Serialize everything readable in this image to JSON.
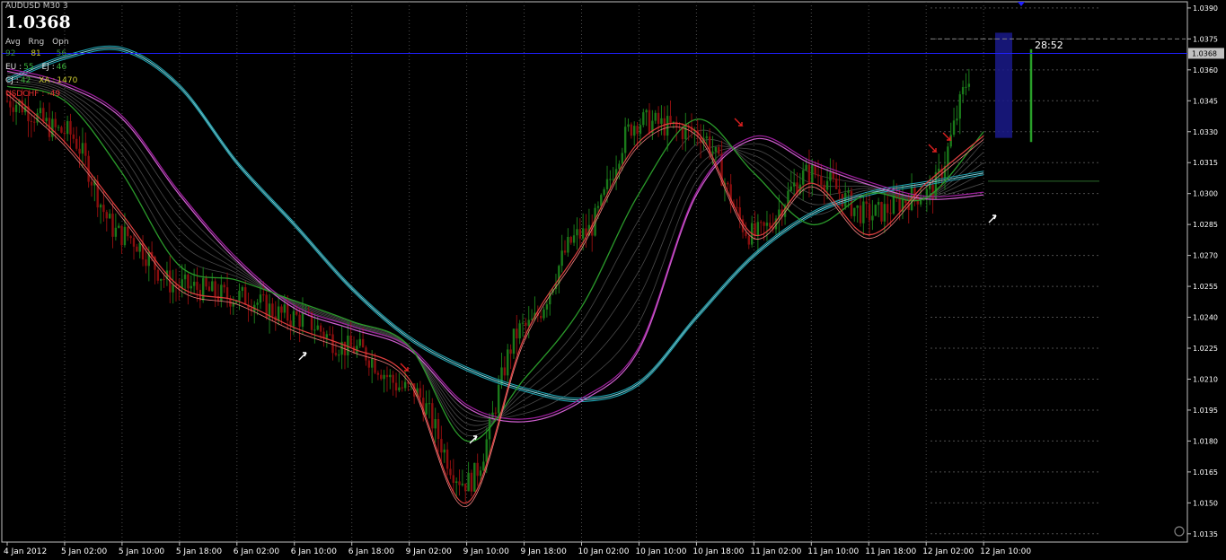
{
  "window": {
    "title": "AUDUSD M30 3"
  },
  "info_panel": {
    "price": "1.0368",
    "col_labels": [
      "Avg",
      "Rng",
      "Opn"
    ],
    "col_values": [
      "92",
      "81",
      "56"
    ],
    "pairs_row1": [
      {
        "label": "EU :",
        "value": "55"
      },
      {
        "label": "EJ :",
        "value": "46"
      }
    ],
    "pairs_row2": [
      {
        "label": "CJ :",
        "value": "42"
      },
      {
        "label": "XA :",
        "value": "1470"
      }
    ],
    "usdchf": {
      "label": "USDCHF :",
      "value": "-49"
    }
  },
  "countdown": "28:52",
  "colors": {
    "background": "#000000",
    "grid": "#4d4d4d",
    "axis": "#c0c0c0",
    "bid_line": "#2020ff",
    "bull": "#1a7a1a",
    "bear": "#8a0e0e",
    "teal": "#1fa7b6",
    "magenta": "#a020a0",
    "green_ma": "#2a9a2a",
    "red_ma": "#e04040"
  },
  "chart_data": {
    "type": "line",
    "symbol": "AUDUSD",
    "timeframe": "M30",
    "bid": 1.0368,
    "ylim": [
      1.0131,
      1.0393
    ],
    "yticks": [
      "1.0390",
      "1.0375",
      "1.0360",
      "1.0345",
      "1.0330",
      "1.0315",
      "1.0300",
      "1.0285",
      "1.0270",
      "1.0255",
      "1.0240",
      "1.0225",
      "1.0210",
      "1.0195",
      "1.0180",
      "1.0165",
      "1.0150",
      "1.0135"
    ],
    "xticks": [
      "4 Jan 2012",
      "5 Jan 02:00",
      "5 Jan 10:00",
      "5 Jan 18:00",
      "6 Jan 02:00",
      "6 Jan 10:00",
      "6 Jan 18:00",
      "9 Jan 02:00",
      "9 Jan 10:00",
      "9 Jan 18:00",
      "10 Jan 02:00",
      "10 Jan 10:00",
      "10 Jan 18:00",
      "11 Jan 02:00",
      "11 Jan 10:00",
      "11 Jan 18:00",
      "12 Jan 02:00",
      "12 Jan 10:00"
    ],
    "series": [
      {
        "role": "slow-teal",
        "x": [
          "4 Jan 2012",
          "5 Jan 02:00",
          "5 Jan 10:00",
          "5 Jan 18:00",
          "6 Jan 02:00",
          "6 Jan 10:00",
          "6 Jan 18:00",
          "9 Jan 02:00",
          "9 Jan 10:00",
          "9 Jan 18:00",
          "10 Jan 02:00",
          "10 Jan 10:00",
          "10 Jan 18:00",
          "11 Jan 02:00",
          "11 Jan 10:00",
          "11 Jan 18:00",
          "12 Jan 02:00",
          "12 Jan 10:00"
        ],
        "y": [
          1.0355,
          1.0366,
          1.037,
          1.0352,
          1.0315,
          1.0285,
          1.0254,
          1.023,
          1.0215,
          1.0205,
          1.02,
          1.0208,
          1.024,
          1.027,
          1.029,
          1.03,
          1.0305,
          1.031
        ]
      },
      {
        "role": "magenta",
        "x": [
          "4 Jan 2012",
          "5 Jan 02:00",
          "5 Jan 10:00",
          "5 Jan 18:00",
          "6 Jan 02:00",
          "6 Jan 10:00",
          "6 Jan 18:00",
          "9 Jan 02:00",
          "9 Jan 10:00",
          "9 Jan 18:00",
          "10 Jan 02:00",
          "10 Jan 10:00",
          "10 Jan 18:00",
          "11 Jan 02:00",
          "11 Jan 10:00",
          "11 Jan 18:00",
          "12 Jan 02:00",
          "12 Jan 10:00"
        ],
        "y": [
          1.036,
          1.0353,
          1.0337,
          1.03,
          1.0268,
          1.0245,
          1.0235,
          1.0225,
          1.0197,
          1.019,
          1.02,
          1.0225,
          1.03,
          1.0327,
          1.0315,
          1.0305,
          1.0298,
          1.03
        ]
      },
      {
        "role": "green-ma",
        "x": [
          "4 Jan 2012",
          "5 Jan 02:00",
          "5 Jan 10:00",
          "5 Jan 18:00",
          "6 Jan 02:00",
          "6 Jan 10:00",
          "6 Jan 18:00",
          "9 Jan 02:00",
          "9 Jan 10:00",
          "9 Jan 18:00",
          "10 Jan 02:00",
          "10 Jan 10:00",
          "10 Jan 18:00",
          "11 Jan 02:00",
          "11 Jan 10:00",
          "11 Jan 18:00",
          "12 Jan 02:00",
          "12 Jan 10:00"
        ],
        "y": [
          1.0352,
          1.0345,
          1.031,
          1.0265,
          1.0258,
          1.0248,
          1.0238,
          1.0226,
          1.018,
          1.021,
          1.0245,
          1.03,
          1.0336,
          1.031,
          1.0285,
          1.03,
          1.0298,
          1.033
        ]
      },
      {
        "role": "red-ma",
        "x": [
          "4 Jan 2012",
          "5 Jan 02:00",
          "5 Jan 10:00",
          "5 Jan 18:00",
          "6 Jan 02:00",
          "6 Jan 10:00",
          "6 Jan 18:00",
          "9 Jan 02:00",
          "9 Jan 10:00",
          "9 Jan 18:00",
          "10 Jan 02:00",
          "10 Jan 10:00",
          "10 Jan 18:00",
          "11 Jan 02:00",
          "11 Jan 10:00",
          "11 Jan 18:00",
          "12 Jan 02:00",
          "12 Jan 10:00"
        ],
        "y": [
          1.035,
          1.0325,
          1.029,
          1.0255,
          1.0248,
          1.0235,
          1.0225,
          1.021,
          1.015,
          1.023,
          1.0275,
          1.0325,
          1.033,
          1.028,
          1.0305,
          1.028,
          1.0305,
          1.0328
        ]
      },
      {
        "role": "price-path",
        "x": [
          "4 Jan 2012",
          "5 Jan 02:00",
          "5 Jan 10:00",
          "5 Jan 18:00",
          "6 Jan 02:00",
          "6 Jan 10:00",
          "6 Jan 18:00",
          "9 Jan 02:00",
          "9 Jan 10:00",
          "9 Jan 18:00",
          "10 Jan 02:00",
          "10 Jan 10:00",
          "10 Jan 18:00",
          "11 Jan 02:00",
          "11 Jan 10:00",
          "11 Jan 18:00",
          "12 Jan 02:00",
          "12 Jan 10:00"
        ],
        "y": [
          1.0345,
          1.033,
          1.028,
          1.0255,
          1.025,
          1.024,
          1.0225,
          1.0205,
          1.016,
          1.0235,
          1.028,
          1.0335,
          1.033,
          1.028,
          1.031,
          1.029,
          1.03,
          1.0368
        ]
      }
    ]
  }
}
